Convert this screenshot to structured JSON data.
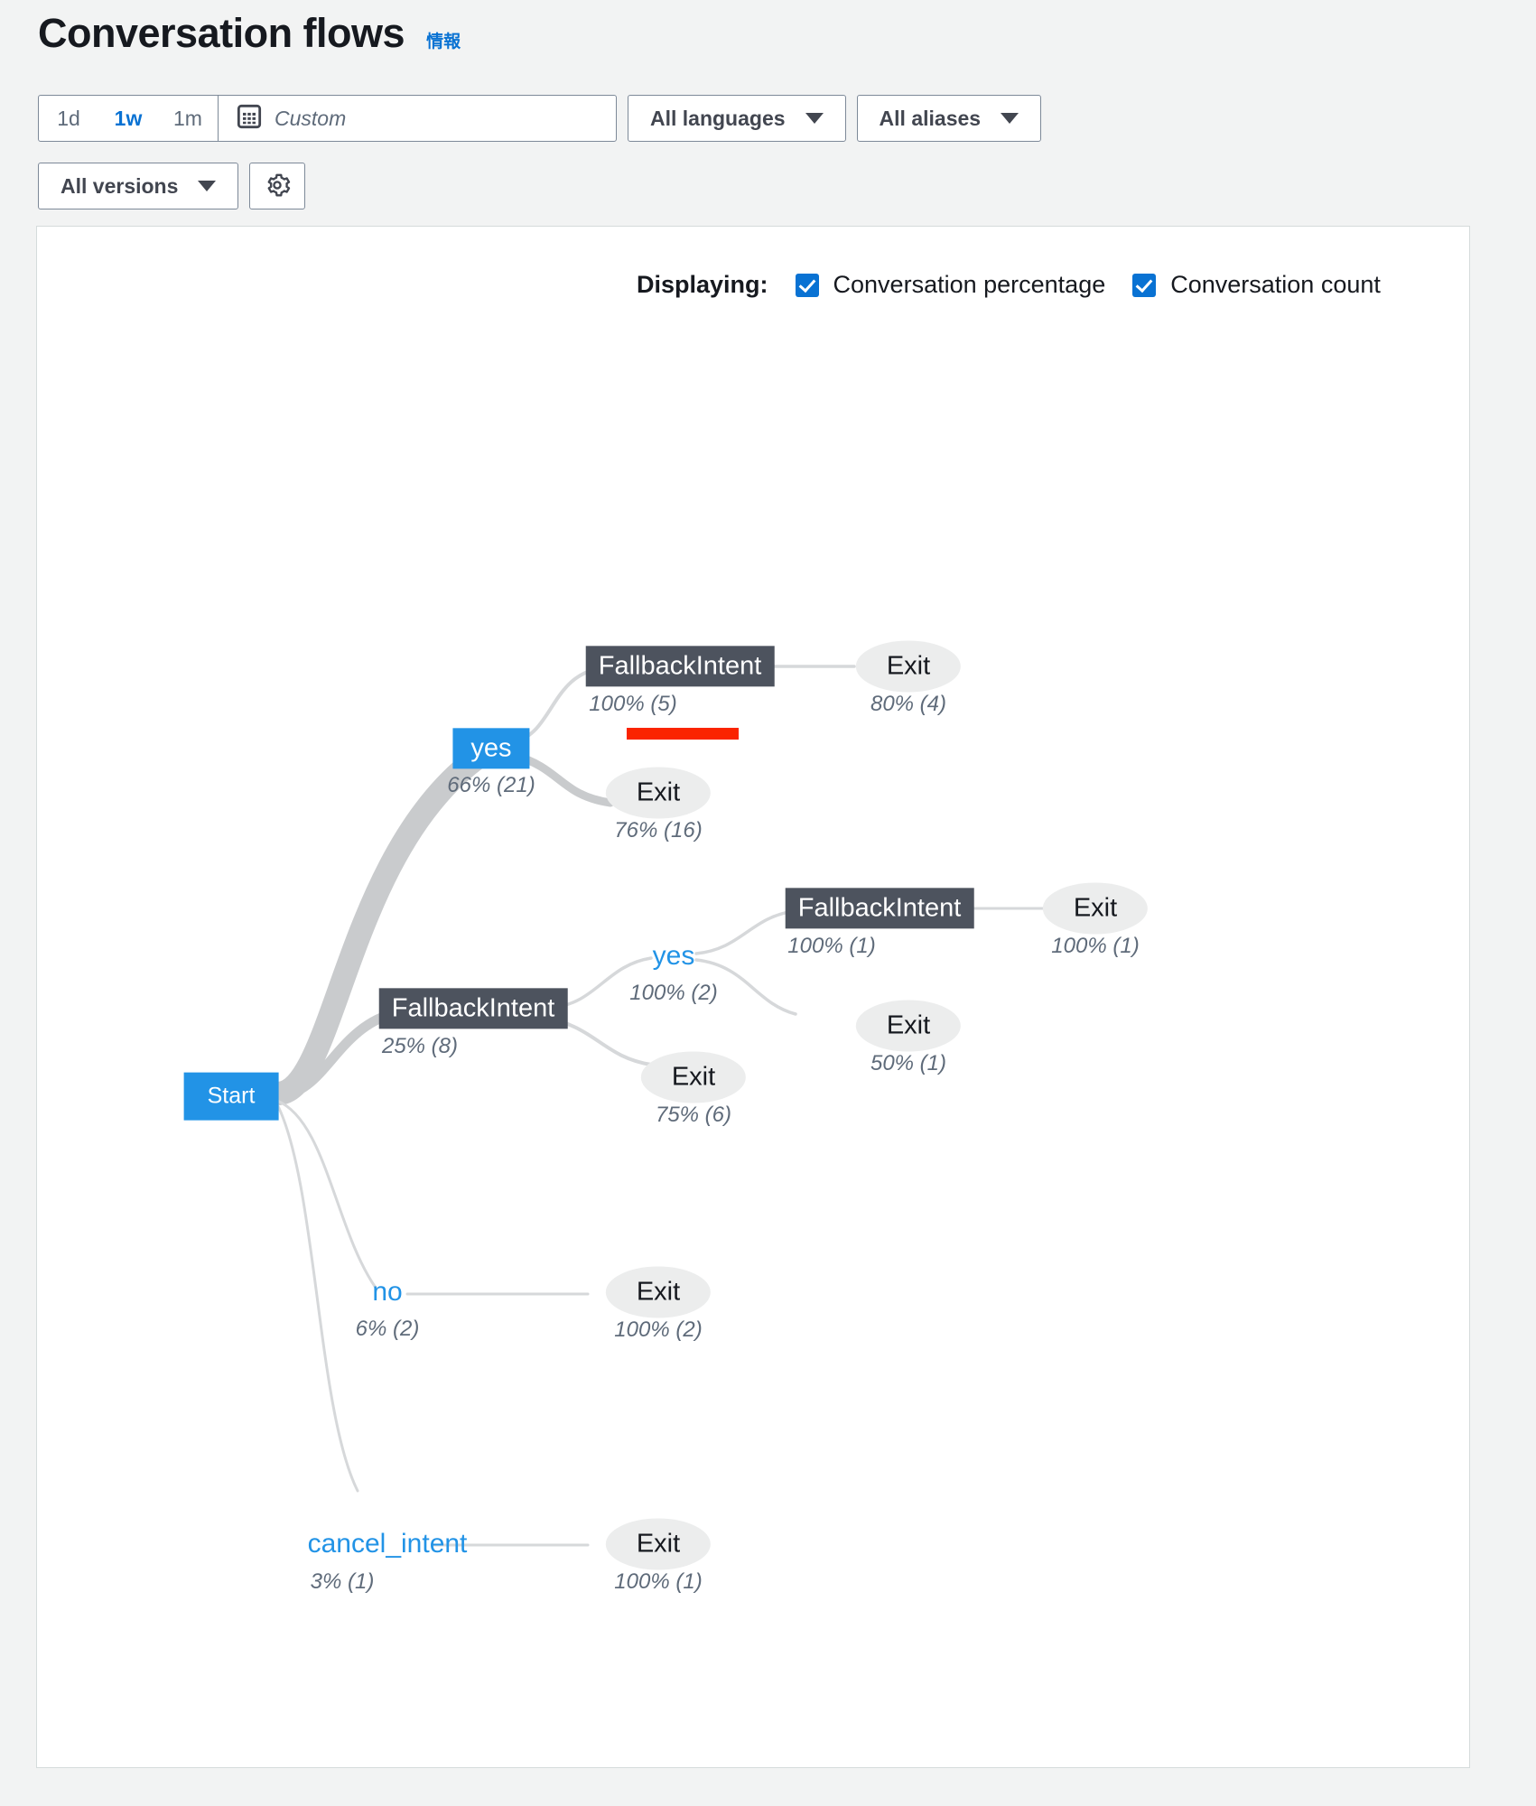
{
  "header": {
    "title": "Conversation flows",
    "info_link": "情報"
  },
  "toolbar": {
    "ranges": [
      {
        "label": "1d",
        "active": false
      },
      {
        "label": "1w",
        "active": true
      },
      {
        "label": "1m",
        "active": false
      }
    ],
    "custom_placeholder": "Custom",
    "calendar_icon": "calendar-icon",
    "languages_label": "All languages",
    "aliases_label": "All aliases",
    "versions_label": "All versions",
    "settings_icon": "gear-icon"
  },
  "displaying": {
    "label": "Displaying:",
    "options": [
      {
        "label": "Conversation percentage",
        "checked": true
      },
      {
        "label": "Conversation count",
        "checked": true
      }
    ]
  },
  "colors": {
    "accent_blue": "#0972d3",
    "node_blue": "#2293e6",
    "intent_gray": "#4d535e",
    "exit_gray": "#eceded",
    "annotation_red": "#fa2400",
    "page_bg": "#f2f3f3"
  },
  "chart_data": {
    "type": "flow-tree",
    "title": "Conversation flows",
    "root": "Start",
    "nodes": [
      {
        "id": "start",
        "label": "Start",
        "metric": "",
        "type": "start"
      },
      {
        "id": "yes1",
        "label": "yes",
        "metric": "66% (21)",
        "type": "filled"
      },
      {
        "id": "fb1",
        "label": "FallbackIntent",
        "metric": "100% (5)",
        "type": "intent"
      },
      {
        "id": "exit1",
        "label": "Exit",
        "metric": "80% (4)",
        "type": "exit"
      },
      {
        "id": "exit2",
        "label": "Exit",
        "metric": "76% (16)",
        "type": "exit"
      },
      {
        "id": "fb2",
        "label": "FallbackIntent",
        "metric": "25% (8)",
        "type": "intent"
      },
      {
        "id": "yes2",
        "label": "yes",
        "metric": "100% (2)",
        "type": "text"
      },
      {
        "id": "fb3",
        "label": "FallbackIntent",
        "metric": "100% (1)",
        "type": "intent"
      },
      {
        "id": "exit3",
        "label": "Exit",
        "metric": "100% (1)",
        "type": "exit"
      },
      {
        "id": "exit4",
        "label": "Exit",
        "metric": "50% (1)",
        "type": "exit"
      },
      {
        "id": "exit5",
        "label": "Exit",
        "metric": "75% (6)",
        "type": "exit"
      },
      {
        "id": "no1",
        "label": "no",
        "metric": "6% (2)",
        "type": "text"
      },
      {
        "id": "exit6",
        "label": "Exit",
        "metric": "100% (2)",
        "type": "exit"
      },
      {
        "id": "cancel1",
        "label": "cancel_intent",
        "metric": "3% (1)",
        "type": "text"
      },
      {
        "id": "exit7",
        "label": "Exit",
        "metric": "100% (1)",
        "type": "exit"
      }
    ],
    "edges": [
      {
        "from": "start",
        "to": "yes1",
        "weight": 21
      },
      {
        "from": "start",
        "to": "fb2",
        "weight": 8
      },
      {
        "from": "start",
        "to": "no1",
        "weight": 2
      },
      {
        "from": "start",
        "to": "cancel1",
        "weight": 1
      },
      {
        "from": "yes1",
        "to": "fb1",
        "weight": 5
      },
      {
        "from": "yes1",
        "to": "exit2",
        "weight": 16
      },
      {
        "from": "fb1",
        "to": "exit1",
        "weight": 4
      },
      {
        "from": "fb2",
        "to": "yes2",
        "weight": 2
      },
      {
        "from": "fb2",
        "to": "exit5",
        "weight": 6
      },
      {
        "from": "yes2",
        "to": "fb3",
        "weight": 1
      },
      {
        "from": "yes2",
        "to": "exit4",
        "weight": 1
      },
      {
        "from": "fb3",
        "to": "exit3",
        "weight": 1
      }
    ],
    "annotations": [
      {
        "target": "fb1",
        "kind": "red-underline",
        "color": "#fa2400"
      }
    ]
  }
}
